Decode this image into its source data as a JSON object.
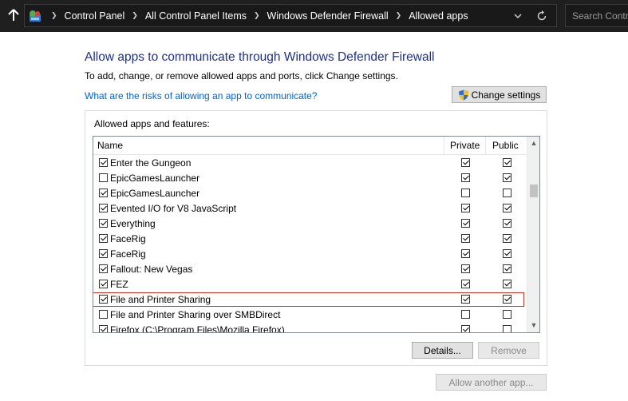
{
  "address_bar": {
    "breadcrumbs": [
      "Control Panel",
      "All Control Panel Items",
      "Windows Defender Firewall",
      "Allowed apps"
    ],
    "search_placeholder": "Search Contro"
  },
  "main": {
    "title": "Allow apps to communicate through Windows Defender Firewall",
    "subtitle": "To add, change, or remove allowed apps and ports, click Change settings.",
    "risk_link": "What are the risks of allowing an app to communicate?",
    "change_settings_label": "Change settings",
    "group_label": "Allowed apps and features:",
    "columns": {
      "name": "Name",
      "private": "Private",
      "public": "Public"
    },
    "apps": [
      {
        "name": "Enter the Gungeon",
        "enabled": true,
        "private": true,
        "public": true
      },
      {
        "name": "EpicGamesLauncher",
        "enabled": false,
        "private": true,
        "public": true
      },
      {
        "name": "EpicGamesLauncher",
        "enabled": true,
        "private": false,
        "public": false
      },
      {
        "name": "Evented I/O for V8 JavaScript",
        "enabled": true,
        "private": true,
        "public": true
      },
      {
        "name": "Everything",
        "enabled": true,
        "private": true,
        "public": true
      },
      {
        "name": "FaceRig",
        "enabled": true,
        "private": true,
        "public": true
      },
      {
        "name": "FaceRig",
        "enabled": true,
        "private": true,
        "public": true
      },
      {
        "name": "Fallout: New Vegas",
        "enabled": true,
        "private": true,
        "public": true
      },
      {
        "name": "FEZ",
        "enabled": true,
        "private": true,
        "public": true
      },
      {
        "name": "File and Printer Sharing",
        "enabled": true,
        "private": true,
        "public": true,
        "highlighted": true
      },
      {
        "name": "File and Printer Sharing over SMBDirect",
        "enabled": false,
        "private": false,
        "public": false
      },
      {
        "name": "Firefox (C:\\Program Files\\Mozilla Firefox)",
        "enabled": true,
        "private": true,
        "public": false
      }
    ],
    "details_label": "Details...",
    "remove_label": "Remove",
    "allow_another_label": "Allow another app..."
  },
  "colors": {
    "title": "#1e3287",
    "link": "#0066cc",
    "address_bar_bg": "#1f1f1f",
    "highlight_border": "#c0392b"
  }
}
